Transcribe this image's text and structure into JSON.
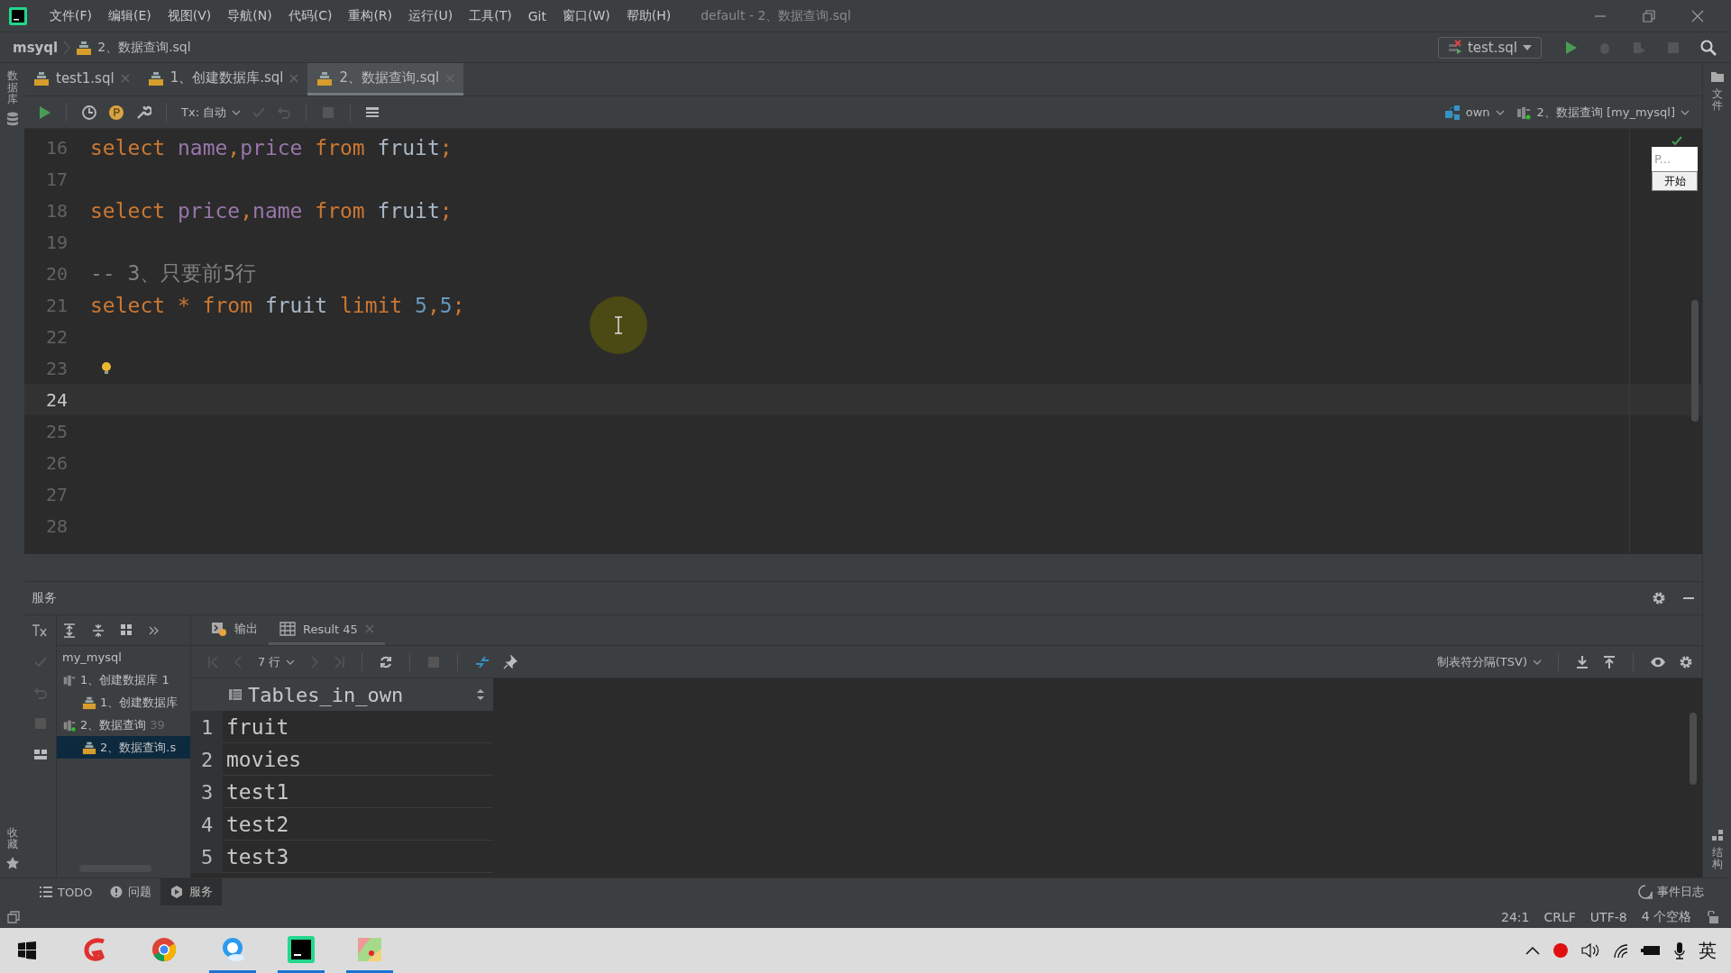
{
  "title_bar": {
    "menu": [
      "文件(F)",
      "编辑(E)",
      "视图(V)",
      "导航(N)",
      "代码(C)",
      "重构(R)",
      "运行(U)",
      "工具(T)",
      "Git",
      "窗口(W)",
      "帮助(H)"
    ],
    "window_title": "default - 2、数据查询.sql"
  },
  "nav_bar": {
    "project": "msyql",
    "file": "2、数据查询.sql",
    "run_config": "test.sql"
  },
  "side_strips": {
    "left_top": "数据库",
    "left_bottom": "收藏",
    "right_top": "文件",
    "right_bottom": "结构"
  },
  "editor_tabs": [
    {
      "label": "test1.sql",
      "selected": false
    },
    {
      "label": "1、创建数据库.sql",
      "selected": false
    },
    {
      "label": "2、数据查询.sql",
      "selected": true
    }
  ],
  "editor_toolbar": {
    "transaction": "Tx: 自动",
    "schema": "own",
    "session": "2、数据查询 [my_mysql]"
  },
  "editor": {
    "lines": [
      {
        "number": "16",
        "current": false,
        "bulb": false,
        "tokens": [
          {
            "kind": "keyword",
            "text": "select "
          },
          {
            "kind": "column",
            "text": "name"
          },
          {
            "kind": "punct",
            "text": ","
          },
          {
            "kind": "column",
            "text": "price "
          },
          {
            "kind": "keyword",
            "text": "from "
          },
          {
            "kind": "table",
            "text": "fruit"
          },
          {
            "kind": "punct",
            "text": ";"
          }
        ]
      },
      {
        "number": "17",
        "current": false,
        "bulb": false
      },
      {
        "number": "18",
        "current": false,
        "bulb": false,
        "tokens": [
          {
            "kind": "keyword",
            "text": "select "
          },
          {
            "kind": "column",
            "text": "price"
          },
          {
            "kind": "punct",
            "text": ","
          },
          {
            "kind": "column",
            "text": "name "
          },
          {
            "kind": "keyword",
            "text": "from "
          },
          {
            "kind": "table",
            "text": "fruit"
          },
          {
            "kind": "punct",
            "text": ";"
          }
        ]
      },
      {
        "number": "19",
        "current": false,
        "bulb": false
      },
      {
        "number": "20",
        "current": false,
        "bulb": false,
        "tokens": [
          {
            "kind": "comment",
            "text": "-- 3、只要前5行"
          }
        ]
      },
      {
        "number": "21",
        "current": false,
        "bulb": false,
        "tokens": [
          {
            "kind": "keyword",
            "text": "select * from "
          },
          {
            "kind": "table",
            "text": "fruit "
          },
          {
            "kind": "keyword",
            "text": "limit "
          },
          {
            "kind": "number",
            "text": "5"
          },
          {
            "kind": "punct",
            "text": ","
          },
          {
            "kind": "number",
            "text": "5"
          },
          {
            "kind": "punct",
            "text": ";"
          }
        ]
      },
      {
        "number": "22",
        "current": false,
        "bulb": false
      },
      {
        "number": "23",
        "current": false,
        "bulb": true
      },
      {
        "number": "24",
        "current": true,
        "bulb": false
      },
      {
        "number": "25",
        "current": false,
        "bulb": false
      },
      {
        "number": "26",
        "current": false,
        "bulb": false
      },
      {
        "number": "27",
        "current": false,
        "bulb": false
      },
      {
        "number": "28",
        "current": false,
        "bulb": false
      }
    ]
  },
  "overlay_widget": {
    "field": "P...",
    "button": "开始"
  },
  "services": {
    "title": "服务",
    "tree": [
      {
        "label": "my_mysql",
        "selected": false,
        "children": [
          {
            "label": "1、创建数据库 1",
            "connected": false,
            "selected": false,
            "children": [
              {
                "label": "1、创建数据库",
                "selected": false
              }
            ]
          },
          {
            "label": "2、数据查询",
            "detail": "39",
            "connected": true,
            "selected": false,
            "children": [
              {
                "label": "2、数据查询.s",
                "selected": true
              }
            ]
          }
        ]
      }
    ],
    "result_tabs": [
      {
        "label": "输出",
        "selected": false
      },
      {
        "label": "Result 45",
        "selected": true
      }
    ],
    "page_size": "7 行",
    "export_format": "制表符分隔(TSV)",
    "grid": {
      "column": "Tables_in_own",
      "rows": [
        {
          "number": "1",
          "value": "fruit"
        },
        {
          "number": "2",
          "value": "movies"
        },
        {
          "number": "3",
          "value": "test1"
        },
        {
          "number": "4",
          "value": "test2"
        },
        {
          "number": "5",
          "value": "test3"
        }
      ]
    }
  },
  "tool_windows": [
    {
      "label": "TODO",
      "selected": false
    },
    {
      "label": "问题",
      "selected": false
    },
    {
      "label": "服务",
      "selected": true
    }
  ],
  "event_log": "事件日志",
  "status_bar": [
    "24:1",
    "CRLF",
    "UTF-8",
    "4 个空格"
  ],
  "taskbar": {
    "apps": [
      {
        "running": false
      },
      {
        "running": false
      },
      {
        "running": true
      },
      {
        "running": true
      },
      {
        "running": true
      }
    ],
    "input_method": "英"
  }
}
